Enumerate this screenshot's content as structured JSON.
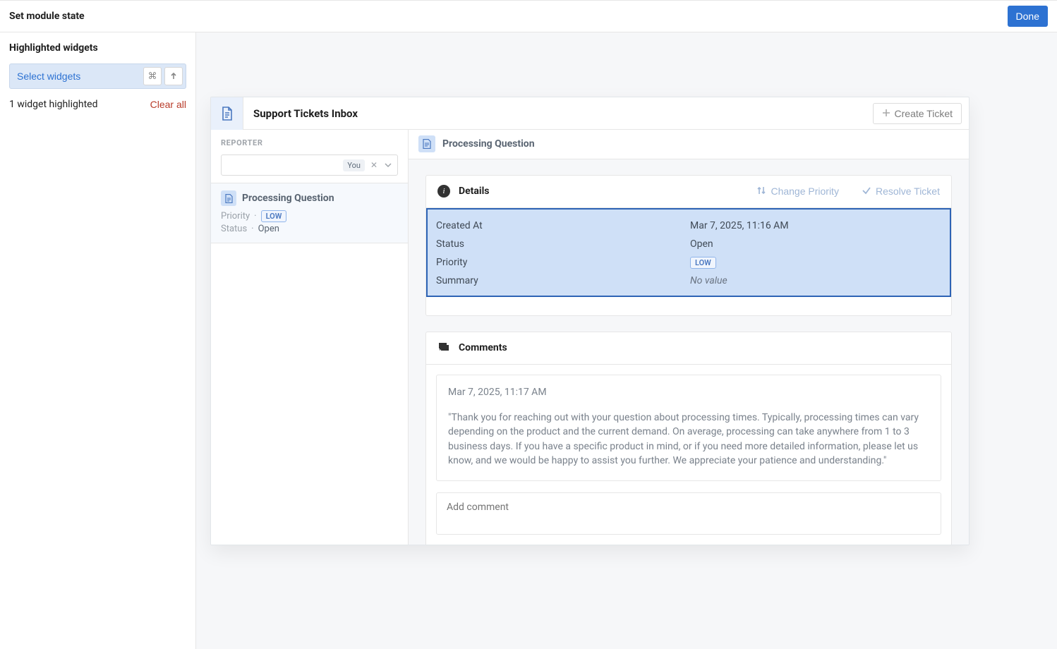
{
  "topbar": {
    "title": "Set module state",
    "done": "Done"
  },
  "sidebar": {
    "heading": "Highlighted widgets",
    "select_widgets_label": "Select widgets",
    "cmd_hint": "⌘",
    "count_text": "1 widget highlighted",
    "clear_all": "Clear all"
  },
  "preview": {
    "title": "Support Tickets Inbox",
    "create_ticket": "Create Ticket"
  },
  "ticket_list": {
    "reporter_label": "REPORTER",
    "you_chip": "You",
    "items": [
      {
        "title": "Processing Question",
        "priority_label": "Priority",
        "priority_tag": "LOW",
        "status_label": "Status",
        "status_value": "Open"
      }
    ]
  },
  "detail_header": {
    "title": "Processing Question"
  },
  "details_card": {
    "title": "Details",
    "change_priority": "Change Priority",
    "resolve_ticket": "Resolve Ticket",
    "rows": {
      "created_at_label": "Created At",
      "created_at_value": "Mar 7, 2025, 11:16 AM",
      "status_label": "Status",
      "status_value": "Open",
      "priority_label": "Priority",
      "priority_value": "LOW",
      "summary_label": "Summary",
      "summary_value": "No value"
    }
  },
  "comments_card": {
    "title": "Comments",
    "comments": [
      {
        "timestamp": "Mar 7, 2025, 11:17 AM",
        "body": "\"Thank you for reaching out with your question about processing times. Typically, processing times can vary depending on the product and the current demand. On average, processing can take anywhere from 1 to 3 business days. If you have a specific product in mind, or if you need more detailed information, please let us know, and we would be happy to assist you further. We appreciate your patience and understanding.\""
      }
    ],
    "add_comment_placeholder": "Add comment"
  }
}
